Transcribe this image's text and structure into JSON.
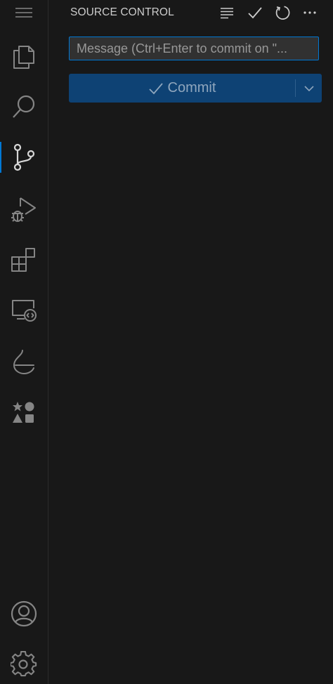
{
  "activity_bar": {
    "items": [
      {
        "icon": "menu-icon"
      },
      {
        "icon": "explorer-icon"
      },
      {
        "icon": "search-icon"
      },
      {
        "icon": "source-control-icon",
        "active": true
      },
      {
        "icon": "run-debug-icon"
      },
      {
        "icon": "extensions-icon"
      },
      {
        "icon": "remote-explorer-icon"
      },
      {
        "icon": "testing-icon"
      },
      {
        "icon": "shapes-icon"
      }
    ],
    "bottom": [
      {
        "icon": "account-icon"
      },
      {
        "icon": "settings-gear-icon"
      }
    ]
  },
  "sidebar": {
    "title": "SOURCE CONTROL",
    "actions": [
      "view-as-tree-icon",
      "commit-check-icon",
      "refresh-icon",
      "more-actions-icon"
    ]
  },
  "scm": {
    "message_placeholder": "Message (Ctrl+Enter to commit on \"...",
    "message_value": "",
    "commit_label": "Commit"
  },
  "colors": {
    "background": "#181818",
    "accent": "#0078d4",
    "commit_button": "#0e4274",
    "foreground": "#cccccc"
  }
}
